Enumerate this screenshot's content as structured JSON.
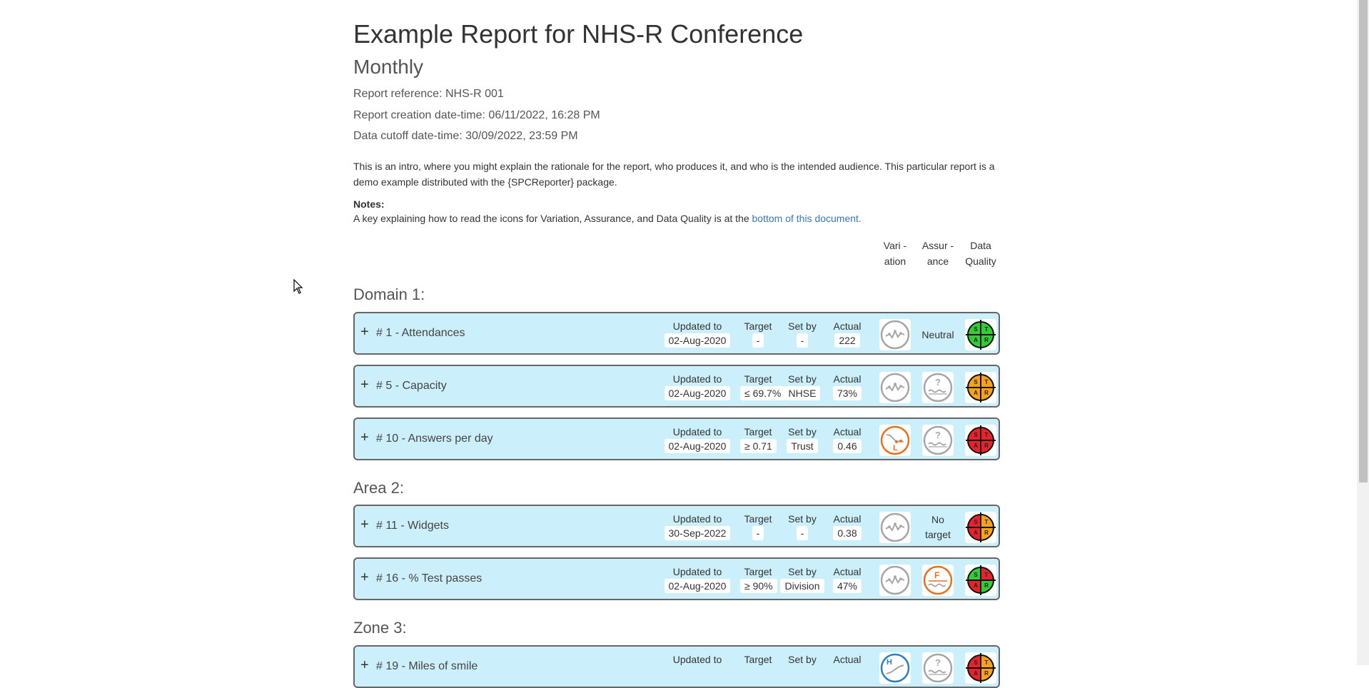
{
  "report": {
    "title": "Example Report for NHS-R Conference",
    "subtitle": "Monthly",
    "reference": "Report reference: NHS-R 001",
    "creation": "Report creation date-time: 06/11/2022, 16:28 PM",
    "cutoff": "Data cutoff date-time: 30/09/2022, 23:59 PM",
    "intro": "This is an intro, where you might explain the rationale for the report, who produces it, and who is the intended audience. This particular report is a demo example distributed with the {SPCReporter} package.",
    "notes_heading": "Notes:",
    "notes_text": "A key explaining how to read the icons for Variation, Assurance, and Data Quality is at the ",
    "notes_link": "bottom of this document."
  },
  "columns": {
    "variation": "Vari - ation",
    "assurance": "Assur - ance",
    "data_quality": "Data Quality"
  },
  "labels": {
    "updated": "Updated to",
    "target": "Target",
    "set_by": "Set by",
    "actual": "Actual",
    "toggle": "+"
  },
  "sections": [
    {
      "title": "Domain 1:"
    },
    {
      "title": "Area 2:"
    },
    {
      "title": "Zone 3:"
    }
  ],
  "measures": [
    {
      "title": "# 1 - Attendances",
      "updated": "02-Aug-2020",
      "target": "-",
      "set_by": "-",
      "actual": "222",
      "variation": "common-cause-icon",
      "assurance": "Neutral",
      "dq": "star-green"
    },
    {
      "title": "# 5 - Capacity",
      "updated": "02-Aug-2020",
      "target": "≤ 69.7%",
      "set_by": "NHSE",
      "actual": "73%",
      "variation": "common-cause-icon",
      "assurance": "inconsistent-icon",
      "dq": "star-amber"
    },
    {
      "title": "# 10 - Answers per day",
      "updated": "02-Aug-2020",
      "target": "≥ 0.71",
      "set_by": "Trust",
      "actual": "0.46",
      "variation": "concern-low-icon",
      "assurance": "inconsistent-icon",
      "dq": "star-red"
    },
    {
      "title": "# 11 - Widgets",
      "updated": "30-Sep-2022",
      "target": "-",
      "set_by": "-",
      "actual": "0.38",
      "variation": "common-cause-icon",
      "assurance": "No target",
      "dq": "star-red-amber"
    },
    {
      "title": "# 16 - % Test passes",
      "updated": "02-Aug-2020",
      "target": "≥ 90%",
      "set_by": "Division",
      "actual": "47%",
      "variation": "common-cause-icon",
      "assurance": "fail-icon",
      "dq": "star-mixed"
    },
    {
      "title": "# 19 - Miles of smile",
      "updated": "",
      "target": "",
      "set_by": "",
      "actual": "",
      "variation": "improvement-high-icon",
      "assurance": "inconsistent-icon",
      "dq": "star-red-amber"
    }
  ],
  "colors": {
    "card_bg": "#ccf0fb",
    "link": "#337ab7",
    "green": "#32cd32",
    "amber": "#f7a21b",
    "red": "#e8222a",
    "orange_special": "#ec6f1c",
    "blue_special": "#2a7fc6",
    "grey_icon": "#a6a6a6"
  }
}
